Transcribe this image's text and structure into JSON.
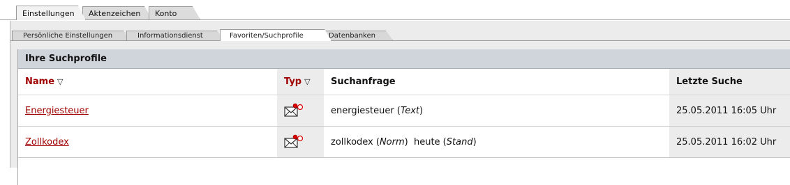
{
  "main_tabs": [
    {
      "label": "Einstellungen",
      "active": true
    },
    {
      "label": "Aktenzeichen",
      "active": false
    },
    {
      "label": "Konto",
      "active": false
    }
  ],
  "sub_tabs": [
    {
      "label": "Persönliche Einstellungen",
      "active": false
    },
    {
      "label": "Informationsdienst",
      "active": false
    },
    {
      "label": "Favoriten/Suchprofile",
      "active": true
    },
    {
      "label": "Datenbanken",
      "active": false
    }
  ],
  "panel": {
    "title": "Ihre Suchprofile",
    "columns": {
      "name": "Name",
      "type": "Typ",
      "query": "Suchanfrage",
      "last_search": "Letzte Suche"
    },
    "sort_icon": "▽",
    "rows": [
      {
        "name": "Energiesteuer",
        "type_icon": "mail-notification-icon",
        "query_parts": [
          {
            "text": "energiesteuer",
            "italic": false
          },
          {
            "text": " (",
            "italic": false
          },
          {
            "text": "Text",
            "italic": true
          },
          {
            "text": ")",
            "italic": false
          }
        ],
        "last_search": "25.05.2011 16:05 Uhr"
      },
      {
        "name": "Zollkodex",
        "type_icon": "mail-notification-icon",
        "query_parts": [
          {
            "text": "zollkodex",
            "italic": false
          },
          {
            "text": " (",
            "italic": false
          },
          {
            "text": "Norm",
            "italic": true
          },
          {
            "text": ")  heute (",
            "italic": false
          },
          {
            "text": "Stand",
            "italic": true
          },
          {
            "text": ")",
            "italic": false
          }
        ],
        "last_search": "25.05.2011 16:02 Uhr"
      }
    ]
  },
  "colors": {
    "link": "#a00000",
    "header_bg": "#d0d5dc",
    "tab_bg": "#dcdcdc"
  }
}
